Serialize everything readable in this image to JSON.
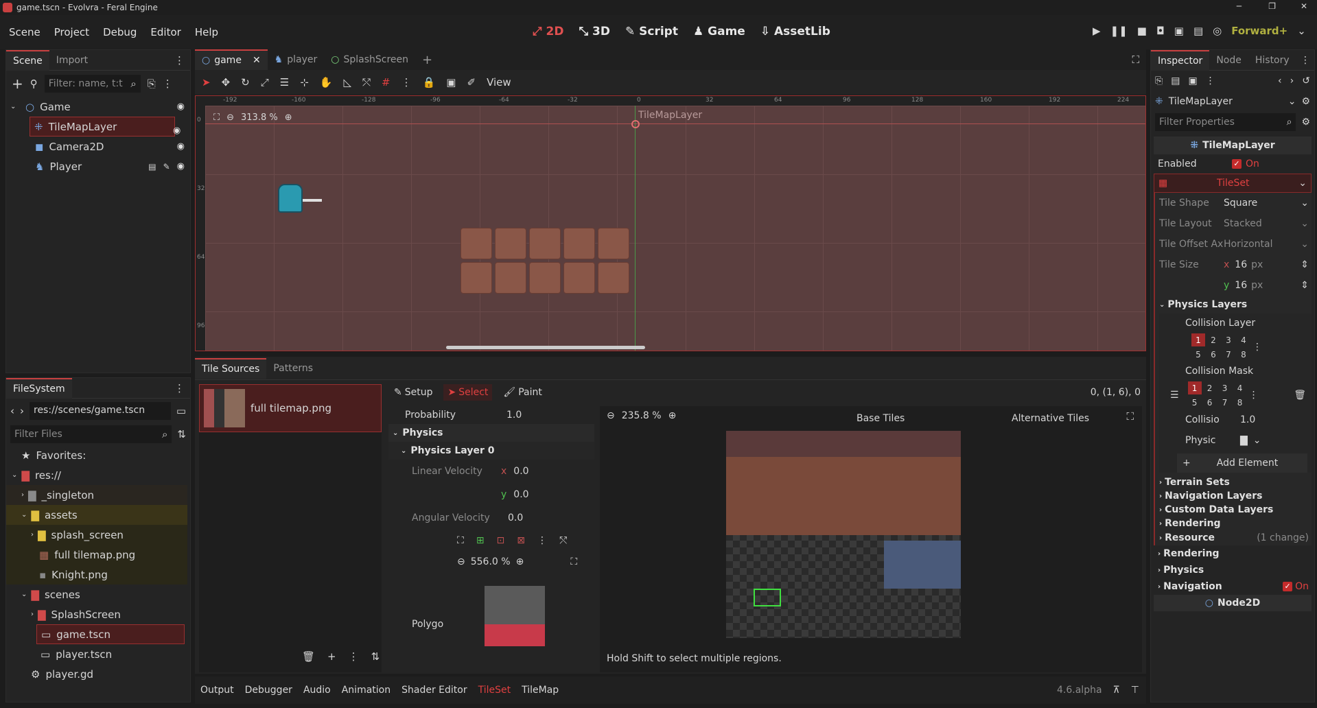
{
  "window": {
    "title": "game.tscn - Evolvra - Feral Engine",
    "min": "─",
    "max": "❐",
    "close": "✕"
  },
  "menu": [
    "Scene",
    "Project",
    "Debug",
    "Editor",
    "Help"
  ],
  "workspaces": [
    {
      "icon": "⤢",
      "label": "2D"
    },
    {
      "icon": "⤡",
      "label": "3D"
    },
    {
      "icon": "✎",
      "label": "Script"
    },
    {
      "icon": "♟",
      "label": "Game"
    },
    {
      "icon": "⇩",
      "label": "AssetLib"
    }
  ],
  "renderer": "Forward+",
  "scene_dock": {
    "tabs": [
      "Scene",
      "Import"
    ],
    "filter_placeholder": "Filter: name, t:t",
    "nodes": [
      {
        "name": "Game",
        "icon": "○"
      },
      {
        "name": "TileMapLayer",
        "icon": "⁜"
      },
      {
        "name": "Camera2D",
        "icon": "◼"
      },
      {
        "name": "Player",
        "icon": "♞"
      }
    ]
  },
  "filesystem": {
    "tab": "FileSystem",
    "path": "res://scenes/game.tscn",
    "filter_placeholder": "Filter Files",
    "items": [
      {
        "label": "Favorites:",
        "icon": "★"
      },
      {
        "label": "res://",
        "icon": "▇"
      },
      {
        "label": "_singleton",
        "icon": "▇"
      },
      {
        "label": "assets",
        "icon": "▇"
      },
      {
        "label": "splash_screen",
        "icon": "▇"
      },
      {
        "label": "full tilemap.png",
        "icon": "▦"
      },
      {
        "label": "Knight.png",
        "icon": "▪"
      },
      {
        "label": "scenes",
        "icon": "▇"
      },
      {
        "label": "SplashScreen",
        "icon": "▇"
      },
      {
        "label": "game.tscn",
        "icon": "▭"
      },
      {
        "label": "player.tscn",
        "icon": "▭"
      },
      {
        "label": "player.gd",
        "icon": "⚙"
      }
    ]
  },
  "editor_tabs": [
    "game",
    "player",
    "SplashScreen"
  ],
  "viewport": {
    "zoom": "313.8 %",
    "view_label": "View",
    "node_label": "TileMapLayer",
    "ruler": [
      "-192",
      "-160",
      "-128",
      "-96",
      "-64",
      "-32",
      "0",
      "32",
      "64",
      "96",
      "128",
      "160",
      "192",
      "224"
    ],
    "vruler": [
      "0",
      "32",
      "64",
      "96"
    ]
  },
  "tileset": {
    "tabs": [
      "Tile Sources",
      "Patterns"
    ],
    "source": "full tilemap.png",
    "modes": [
      "Setup",
      "Select",
      "Paint"
    ],
    "coords": "0, (1, 6), 0",
    "probability_label": "Probability",
    "probability": "1.0",
    "physics": "Physics",
    "physics_layer": "Physics Layer 0",
    "linear_velocity": "Linear Velocity",
    "lv_x": "0.0",
    "lv_y": "0.0",
    "angular_velocity": "Angular Velocity",
    "av": "0.0",
    "poly_zoom": "556.0 %",
    "polygon": "Polygo",
    "atlas_zoom": "235.8 %",
    "base_tiles": "Base Tiles",
    "alt_tiles": "Alternative Tiles",
    "hint": "Hold Shift to select multiple regions."
  },
  "bottom_tabs": [
    "Output",
    "Debugger",
    "Audio",
    "Animation",
    "Shader Editor",
    "TileSet",
    "TileMap"
  ],
  "version": "4.6.alpha",
  "inspector": {
    "tabs": [
      "Inspector",
      "Node",
      "History"
    ],
    "node": "TileMapLayer",
    "filter_placeholder": "Filter Properties",
    "section": "TileMapLayer",
    "enabled": "Enabled",
    "on": "On",
    "tileset": "TileSet",
    "tile_shape": "Tile Shape",
    "tile_shape_val": "Square",
    "tile_layout": "Tile Layout",
    "tile_layout_val": "Stacked",
    "tile_offset": "Tile Offset Ax",
    "tile_offset_val": "Horizontal",
    "tile_size": "Tile Size",
    "ts_x": "16",
    "ts_y": "16",
    "px": "px",
    "physics_layers": "Physics Layers",
    "collision_layer": "Collision Layer",
    "collision_mask": "Collision Mask",
    "collision_priority": "Collisio",
    "collision_priority_val": "1.0",
    "physic": "Physic",
    "add_element": "Add Element",
    "terrain_sets": "Terrain Sets",
    "navigation_layers": "Navigation Layers",
    "custom_data": "Custom Data Layers",
    "rendering": "Rendering",
    "resource": "Resource",
    "resource_changes": "(1 change)",
    "rendering2": "Rendering",
    "physics": "Physics",
    "navigation": "Navigation",
    "node2d": "Node2D"
  },
  "colors": {
    "accent": "#c94040",
    "selection": "#4a1e1e",
    "viewport_bg": "#5a3e3e",
    "tile": "#8a5748"
  }
}
